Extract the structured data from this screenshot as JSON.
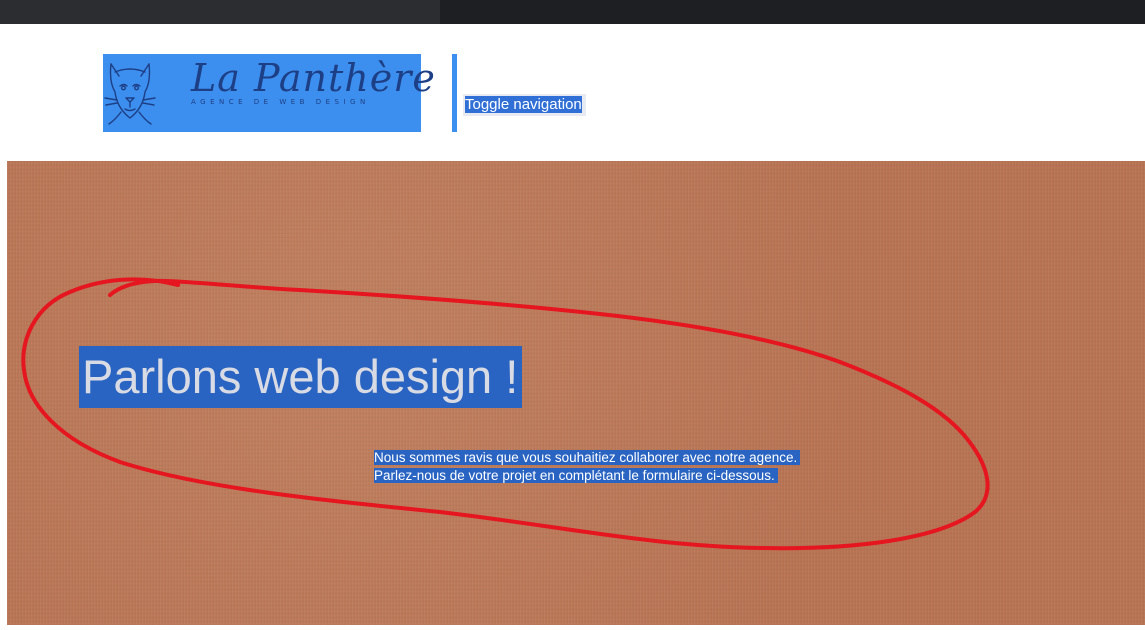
{
  "logo": {
    "title": "La Panthère",
    "subtitle": "AGENCE DE WEB DESIGN",
    "icon": "panther-head-icon",
    "background_color": "#3c8fef"
  },
  "nav": {
    "toggle_label": "Toggle navigation"
  },
  "hero": {
    "title": "Parlons web design !",
    "lines": [
      "Nous sommes ravis que vous souhaitiez collaborer avec notre agence.",
      "Parlez-nous de votre projet en complétant le formulaire ci-dessous."
    ],
    "background_color": "#b87352",
    "selection_color": "#2a64c2"
  },
  "annotation": {
    "shape": "hand-drawn-ellipse",
    "color": "#e5161f"
  }
}
